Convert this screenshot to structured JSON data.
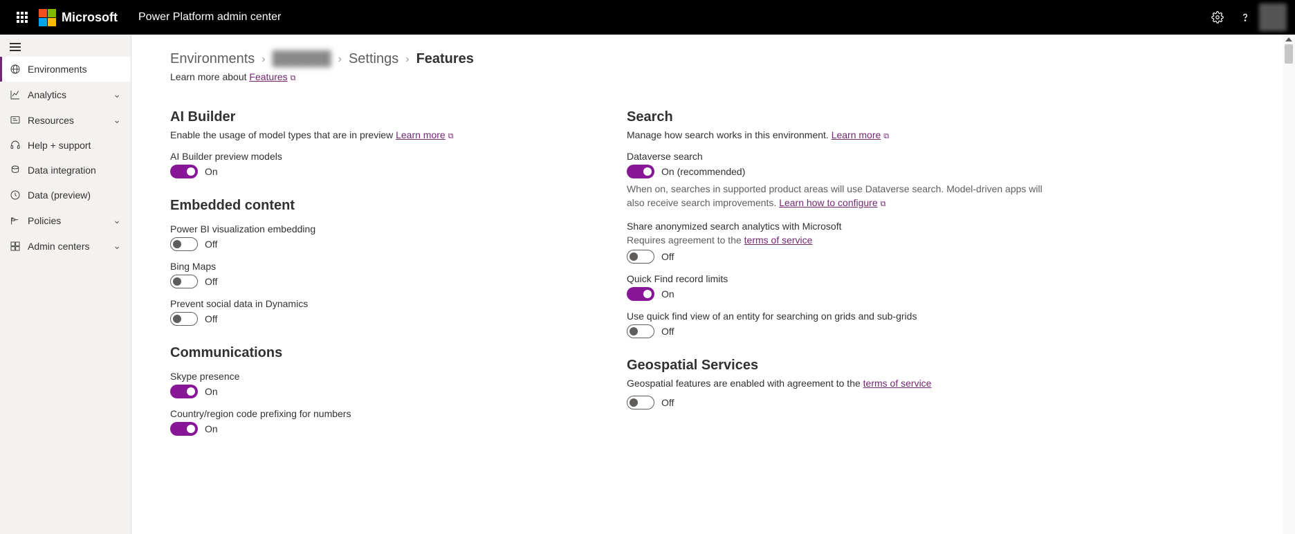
{
  "header": {
    "brand": "Microsoft",
    "app_title": "Power Platform admin center"
  },
  "sidebar": {
    "items": [
      {
        "label": "Environments",
        "icon": "globe-icon",
        "active": true,
        "expandable": false
      },
      {
        "label": "Analytics",
        "icon": "chart-icon",
        "active": false,
        "expandable": true
      },
      {
        "label": "Resources",
        "icon": "resources-icon",
        "active": false,
        "expandable": true
      },
      {
        "label": "Help + support",
        "icon": "headset-icon",
        "active": false,
        "expandable": false
      },
      {
        "label": "Data integration",
        "icon": "data-integration-icon",
        "active": false,
        "expandable": false
      },
      {
        "label": "Data (preview)",
        "icon": "data-preview-icon",
        "active": false,
        "expandable": false
      },
      {
        "label": "Policies",
        "icon": "policies-icon",
        "active": false,
        "expandable": true
      },
      {
        "label": "Admin centers",
        "icon": "admin-centers-icon",
        "active": false,
        "expandable": true
      }
    ]
  },
  "breadcrumb": {
    "environments": "Environments",
    "env_name": "██████",
    "settings": "Settings",
    "current": "Features"
  },
  "learn_more_line": {
    "prefix": "Learn more about ",
    "link": "Features"
  },
  "left_col": {
    "ai_builder": {
      "heading": "AI Builder",
      "desc_prefix": "Enable the usage of model types that are in preview ",
      "desc_link": "Learn more",
      "toggle1_label": "AI Builder preview models",
      "toggle1_state": "On"
    },
    "embedded": {
      "heading": "Embedded content",
      "t1_label": "Power BI visualization embedding",
      "t1_state": "Off",
      "t2_label": "Bing Maps",
      "t2_state": "Off",
      "t3_label": "Prevent social data in Dynamics",
      "t3_state": "Off"
    },
    "comms": {
      "heading": "Communications",
      "t1_label": "Skype presence",
      "t1_state": "On",
      "t2_label": "Country/region code prefixing for numbers",
      "t2_state": "On"
    }
  },
  "right_col": {
    "search": {
      "heading": "Search",
      "desc_prefix": "Manage how search works in this environment. ",
      "desc_link": "Learn more",
      "dv_label": "Dataverse search",
      "dv_state": "On (recommended)",
      "dv_hint_prefix": "When on, searches in supported product areas will use Dataverse search. Model-driven apps will also receive search improvements. ",
      "dv_hint_link": "Learn how to configure",
      "anon_label": "Share anonymized search analytics with Microsoft",
      "anon_sub_prefix": "Requires agreement to the ",
      "anon_sub_link": "terms of service",
      "anon_state": "Off",
      "qf_label": "Quick Find record limits",
      "qf_state": "On",
      "qfv_label": "Use quick find view of an entity for searching on grids and sub-grids",
      "qfv_state": "Off"
    },
    "geo": {
      "heading": "Geospatial Services",
      "desc_prefix": "Geospatial features are enabled with agreement to the ",
      "desc_link": "terms of service",
      "state": "Off"
    }
  }
}
